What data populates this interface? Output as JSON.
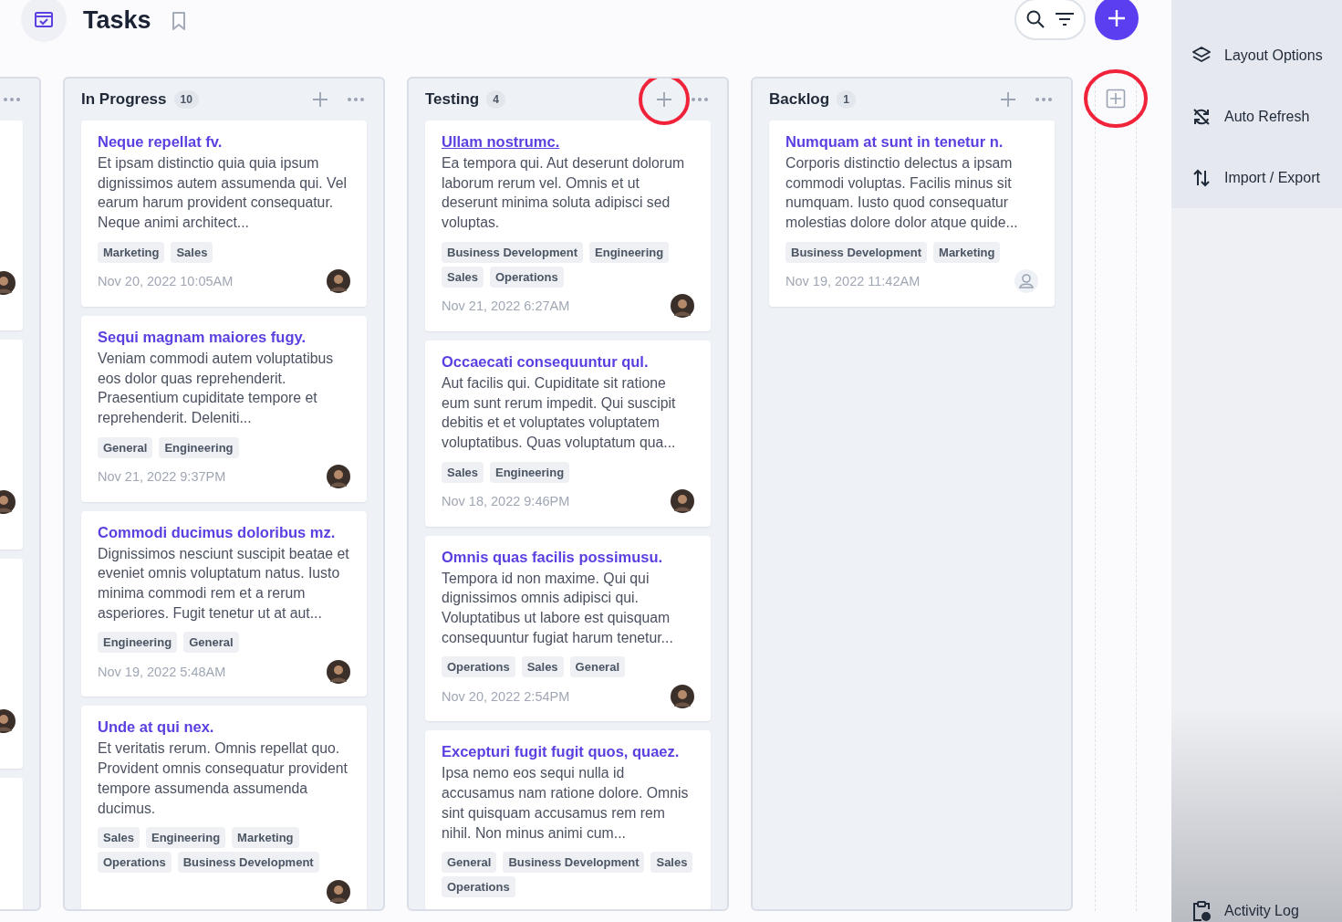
{
  "header": {
    "title": "Tasks"
  },
  "columns": [
    {
      "title": "In Progress",
      "count": "10",
      "add_highlighted": false,
      "cards": [
        {
          "title": "Neque repellat fv.",
          "hovered": false,
          "body": "Et ipsam distinctio quia quia ipsum dignissimos autem assumenda qui. Vel earum harum provident consequatur. Neque animi architect...",
          "tags": [
            "Marketing",
            "Sales"
          ],
          "date": "Nov 20, 2022 10:05AM",
          "assigned": true
        },
        {
          "title": "Sequi magnam maiores fugy.",
          "hovered": false,
          "body": "Veniam commodi autem voluptatibus eos dolor quas reprehenderit. Praesentium cupiditate tempore et reprehenderit. Deleniti...",
          "tags": [
            "General",
            "Engineering"
          ],
          "date": "Nov 21, 2022 9:37PM",
          "assigned": true
        },
        {
          "title": "Commodi ducimus doloribus mz.",
          "hovered": false,
          "body": "Dignissimos nesciunt suscipit beatae et eveniet omnis voluptatum natus. Iusto minima commodi rem et a rerum asperiores. Fugit tenetur ut at aut...",
          "tags": [
            "Engineering",
            "General"
          ],
          "date": "Nov 19, 2022 5:48AM",
          "assigned": true
        },
        {
          "title": "Unde at qui nex.",
          "hovered": false,
          "body": "Et veritatis rerum. Omnis repellat quo. Provident omnis consequatur provident tempore assumenda assumenda ducimus.",
          "tags": [
            "Sales",
            "Engineering",
            "Marketing",
            "Operations",
            "Business Development"
          ],
          "assigned": true
        }
      ]
    },
    {
      "title": "Testing",
      "count": "4",
      "add_highlighted": true,
      "cards": [
        {
          "title": "Ullam nostrumc.",
          "hovered": true,
          "body": "Ea tempora qui. Aut deserunt dolorum laborum rerum vel. Omnis et ut deserunt minima soluta adipisci sed voluptas.",
          "tags": [
            "Business Development",
            "Engineering",
            "Sales",
            "Operations"
          ],
          "date": "Nov 21, 2022 6:27AM",
          "assigned": true
        },
        {
          "title": "Occaecati consequuntur qul.",
          "hovered": false,
          "body": "Aut facilis qui. Cupiditate sit ratione eum sunt rerum impedit. Qui suscipit debitis et et voluptates voluptatem voluptatibus. Quas voluptatum qua...",
          "tags": [
            "Sales",
            "Engineering"
          ],
          "date": "Nov 18, 2022 9:46PM",
          "assigned": true
        },
        {
          "title": "Omnis quas facilis possimusu.",
          "hovered": false,
          "body": "Tempora id non maxime. Qui qui dignissimos omnis adipisci qui. Voluptatibus ut labore est quisquam consequuntur fugiat harum tenetur...",
          "tags": [
            "Operations",
            "Sales",
            "General"
          ],
          "date": "Nov 20, 2022 2:54PM",
          "assigned": true
        },
        {
          "title": "Excepturi fugit fugit quos, quaez.",
          "hovered": false,
          "body": "Ipsa nemo eos sequi nulla id accusamus nam ratione dolore. Omnis sint quisquam accusamus rem rem nihil. Non minus animi cum...",
          "tags": [
            "General",
            "Business Development",
            "Sales",
            "Operations"
          ]
        }
      ]
    },
    {
      "title": "Backlog",
      "count": "1",
      "add_highlighted": false,
      "cards": [
        {
          "title": "Numquam at sunt in tenetur n.",
          "hovered": false,
          "body": "Corporis distinctio delectus a ipsam commodi voluptas. Facilis minus sit numquam. Iusto quod consequatur molestias dolore dolor atque quide...",
          "tags": [
            "Business Development",
            "Marketing"
          ],
          "date": "Nov 19, 2022 11:42AM",
          "assigned": false
        }
      ]
    }
  ],
  "add_column": {
    "highlighted": true
  },
  "sidebar": {
    "items": [
      {
        "label": "Layout Options"
      },
      {
        "label": "Auto Refresh"
      },
      {
        "label": "Import / Export"
      }
    ],
    "footer_item": {
      "label": "Activity Log"
    }
  }
}
